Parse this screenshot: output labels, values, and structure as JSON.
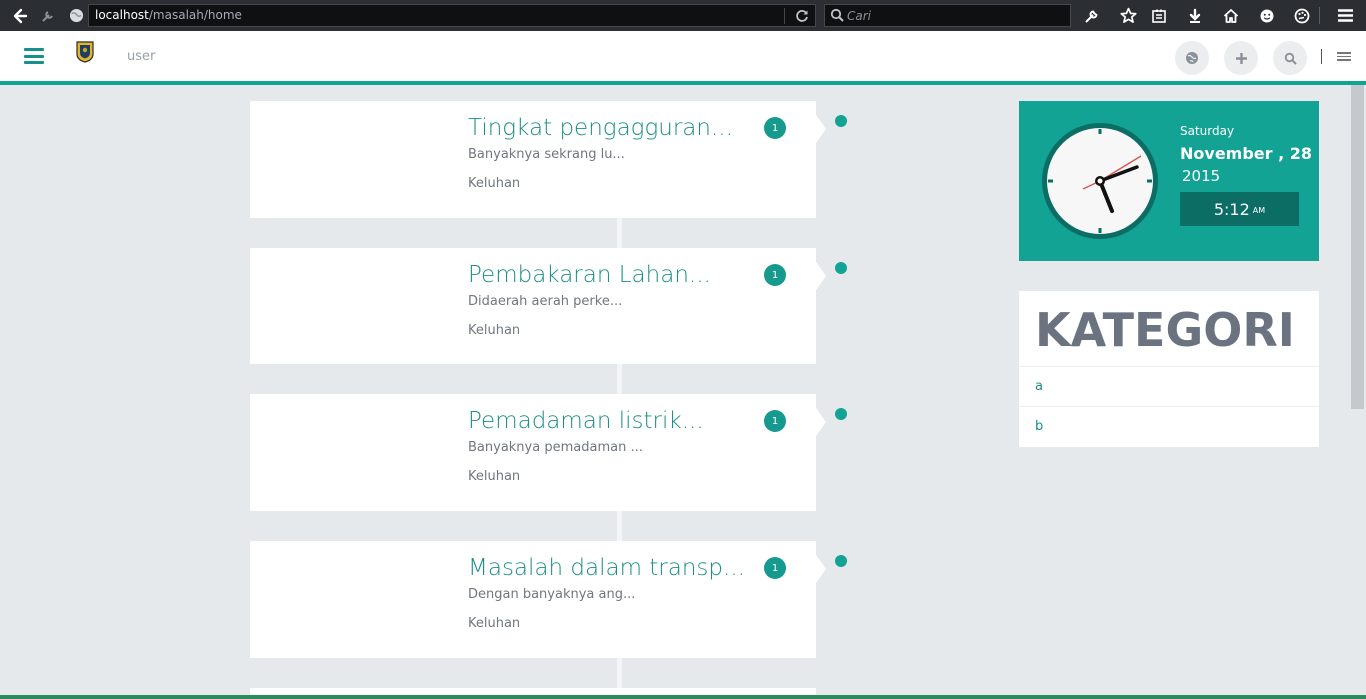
{
  "browser": {
    "url_host": "localhost",
    "url_path": "/masalah/home",
    "search_placeholder": "Cari"
  },
  "header": {
    "user_label": "user"
  },
  "posts": [
    {
      "title": "Tingkat pengagguran...",
      "description": "Banyaknya sekrang lu...",
      "category": "Keluhan",
      "count": "1"
    },
    {
      "title": "Pembakaran Lahan...",
      "description": "Didaerah aerah perke...",
      "category": "Keluhan",
      "count": "1"
    },
    {
      "title": "Pemadaman listrik...",
      "description": "Banyaknya pemadaman ...",
      "category": "Keluhan",
      "count": "1"
    },
    {
      "title": "Masalah dalam transp...",
      "description": "Dengan banyaknya ang...",
      "category": "Keluhan",
      "count": "1"
    }
  ],
  "clock": {
    "day": "Saturday",
    "date": "November , 28",
    "year": "2015",
    "time": "5:12",
    "ampm": "AM"
  },
  "kategori": {
    "title": "KATEGORI",
    "items": [
      "a",
      "b"
    ]
  },
  "colors": {
    "accent": "#12a394",
    "title_text": "#1a8f85",
    "background": "#e6e9ec"
  }
}
